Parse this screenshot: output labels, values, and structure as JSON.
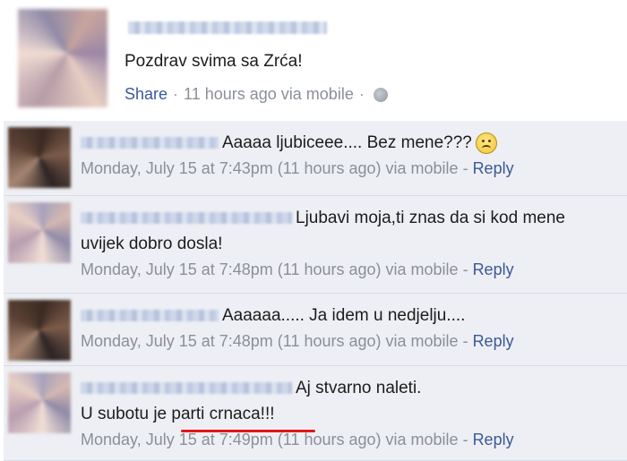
{
  "post": {
    "text": "Pozdrav svima sa Zrća!",
    "share_label": "Share",
    "separator": "·",
    "time_text": "11 hours ago via mobile",
    "separator2": "·"
  },
  "comments": [
    {
      "text": "Aaaaa ljubiceee.... Bez mene???",
      "meta": "Monday, July 15 at 7:43pm (11 hours ago) via mobile",
      "reply_prefix": " - ",
      "reply": "Reply"
    },
    {
      "text_line1": "Ljubavi moja,ti znas da si kod mene",
      "text_line2": "uvijek dobro dosla!",
      "meta": "Monday, July 15 at 7:48pm (11 hours ago) via mobile",
      "reply_prefix": " - ",
      "reply": "Reply"
    },
    {
      "text": "Aaaaaa..... Ja idem u nedjelju....",
      "meta": "Monday, July 15 at 7:48pm (11 hours ago) via mobile",
      "reply_prefix": " - ",
      "reply": "Reply"
    },
    {
      "text_line1": "Aj stvarno naleti.",
      "text_line2": "U subotu je parti crnaca!!!",
      "meta": "Monday, July 15 at 7:49pm (11 hours ago) via mobile",
      "reply_prefix": " - ",
      "reply": "Reply"
    }
  ],
  "colors": {
    "link": "#3b5998",
    "meta": "#8a8f98",
    "comment_bg": "#edeff4",
    "underline": "#e0161a"
  },
  "icons": {
    "privacy": "globe-icon",
    "emoticon": "sad-face-icon"
  }
}
